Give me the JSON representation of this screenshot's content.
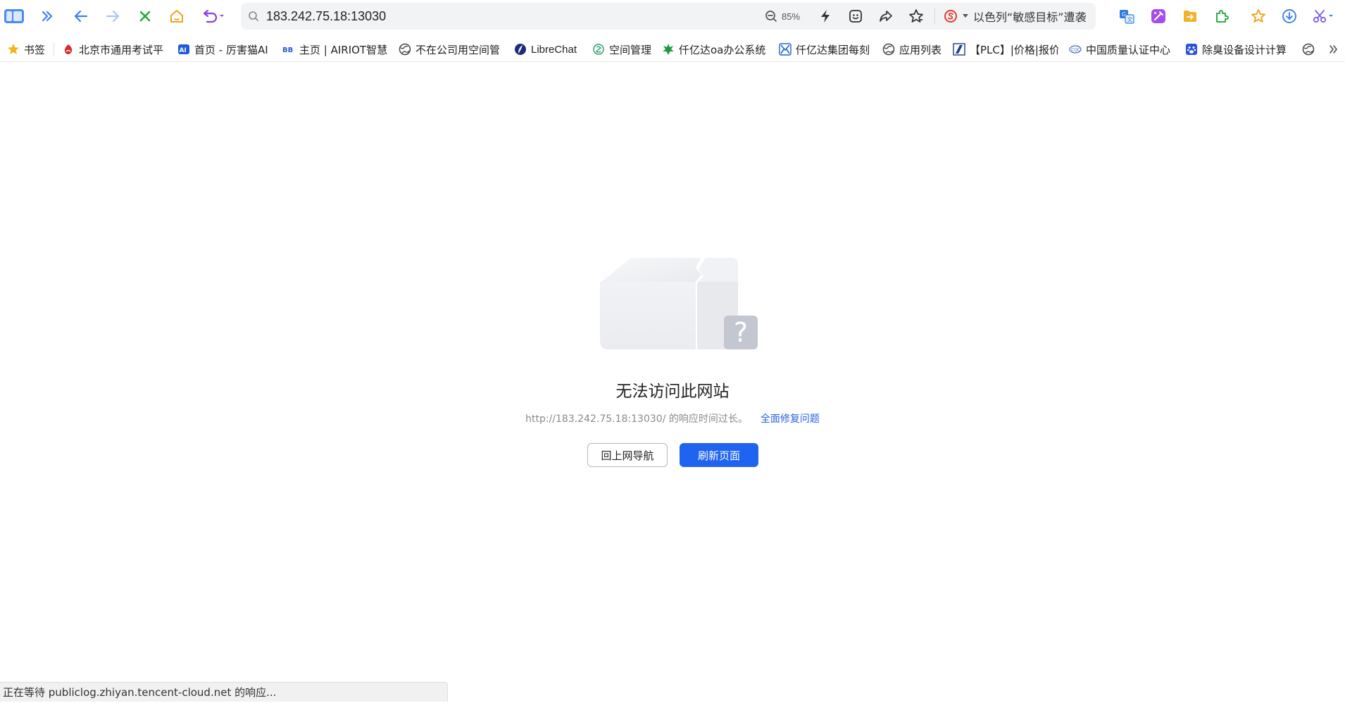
{
  "toolbar": {
    "url": "183.242.75.18:13030",
    "zoom": "85%",
    "hot_search": "以色列“敏感目标”遭袭"
  },
  "bookmarks": [
    {
      "label": "书签"
    },
    {
      "label": "北京市通用考试平"
    },
    {
      "label": "首页 - 厉害猫AI"
    },
    {
      "label": "主页 | AIRIOT智慧"
    },
    {
      "label": "不在公司用空间管"
    },
    {
      "label": "LibreChat"
    },
    {
      "label": "空间管理"
    },
    {
      "label": "仟亿达oa办公系统"
    },
    {
      "label": "仟亿达集团每刻"
    },
    {
      "label": "应用列表"
    },
    {
      "label": "【PLC】|价格|报价"
    },
    {
      "label": "中国质量认证中心"
    },
    {
      "label": "除臭设备设计计算"
    }
  ],
  "error": {
    "title": "无法访问此网站",
    "description": "http://183.242.75.18:13030/ 的响应时间过长。",
    "fix_link": "全面修复问题",
    "nav_button": "回上网导航",
    "refresh_button": "刷新页面"
  },
  "status": {
    "text": "正在等待 publiclog.zhiyan.tencent-cloud.net 的响应..."
  },
  "colors": {
    "accent": "#1f63f1",
    "link": "#2b62e6"
  }
}
